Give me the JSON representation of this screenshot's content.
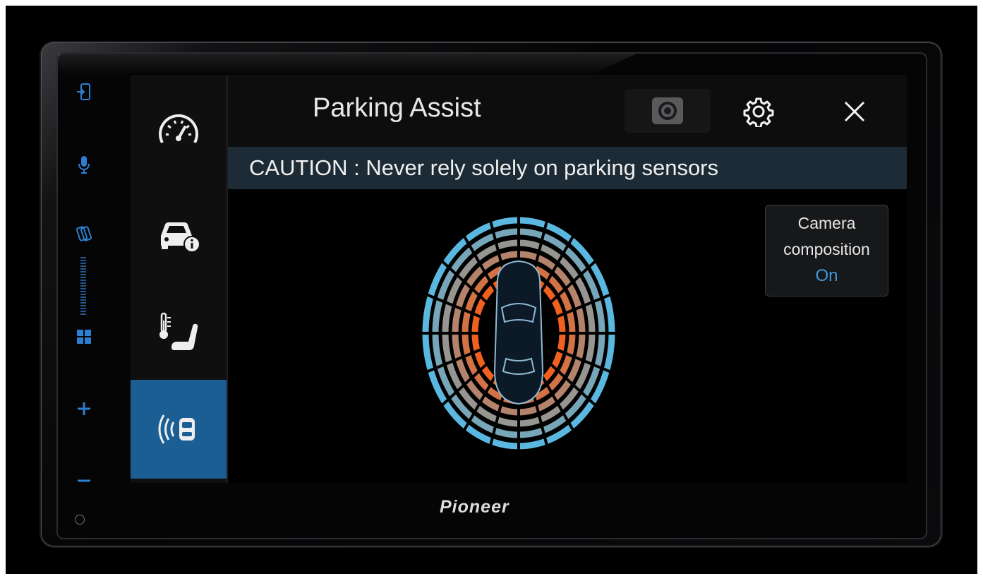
{
  "header": {
    "title": "Parking Assist"
  },
  "caution_text": "CAUTION : Never rely solely on parking sensors",
  "camera_composition": {
    "label_line1": "Camera",
    "label_line2": "composition",
    "value": "On"
  },
  "brand": "Pioneer",
  "sidebar": {
    "items": [
      {
        "icon": "speedometer-icon",
        "active": false
      },
      {
        "icon": "car-info-icon",
        "active": false
      },
      {
        "icon": "seat-temperature-icon",
        "active": false
      },
      {
        "icon": "parking-sensor-icon",
        "active": true
      }
    ]
  },
  "hardware_buttons": [
    "source-icon",
    "microphone-icon",
    "connection-icon",
    "volume-level",
    "home-grid-icon",
    "plus-icon",
    "minus-icon"
  ],
  "colors": {
    "accent_blue": "#2d7fd1",
    "active_tab": "#1b5e93",
    "sensor_near": "#f0601e",
    "sensor_far": "#5ab8e0"
  }
}
